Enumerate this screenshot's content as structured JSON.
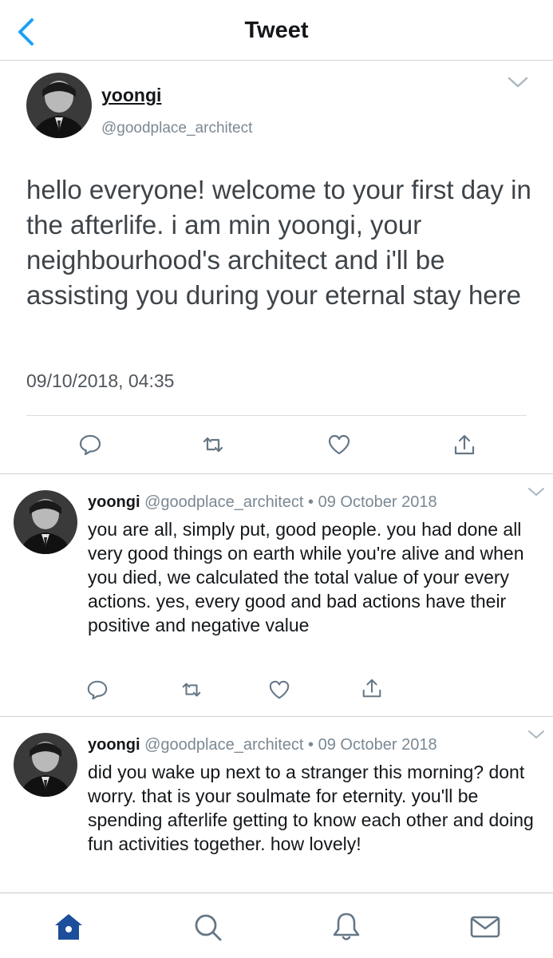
{
  "header": {
    "title": "Tweet",
    "back_icon": "chevron-left-icon"
  },
  "main_tweet": {
    "display_name": "yoongi",
    "handle": "@goodplace_architect",
    "text": "hello everyone! welcome to your first day in the afterlife. i am min yoongi, your neighbourhood's architect and i'll be assisting you during your eternal stay here",
    "timestamp": "09/10/2018, 04:35",
    "actions": [
      "reply-icon",
      "retweet-icon",
      "like-icon",
      "share-icon"
    ]
  },
  "replies": [
    {
      "display_name": "yoongi",
      "handle": "@goodplace_architect",
      "separator": "•",
      "date": "09 October 2018",
      "text": "you are all, simply put, good people. you had done all very good things on earth while you're alive and when you died, we calculated the total value of your every actions. yes, every good and bad actions have their positive and negative value"
    },
    {
      "display_name": "yoongi",
      "handle": "@goodplace_architect",
      "separator": "•",
      "date": "09 October 2018",
      "text": "did you wake up next to a stranger this morning? dont worry. that is your soulmate for eternity. you'll be spending afterlife getting to know each other and doing fun activities together. how lovely!"
    }
  ],
  "tabbar": {
    "items": [
      "home-icon",
      "search-icon",
      "notifications-icon",
      "messages-icon"
    ],
    "active": "home-icon"
  },
  "colors": {
    "accent": "#1da1f2",
    "icon_gray": "#657786",
    "tab_active": "#1b4e9b",
    "text_dark": "#14171a",
    "text_gray": "#7b8893"
  }
}
